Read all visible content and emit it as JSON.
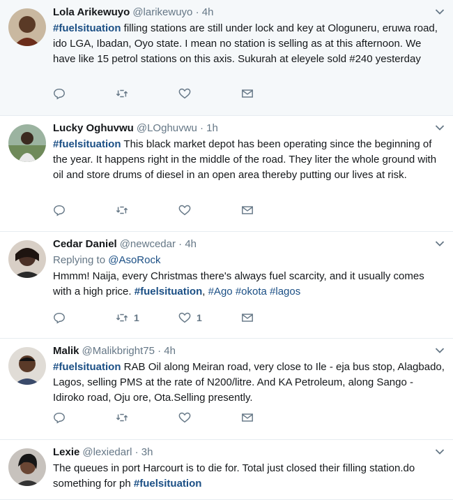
{
  "tweets": [
    {
      "name": "Lola Arikewuyo",
      "handle": "@larikewuyo",
      "time": "4h",
      "segments": [
        {
          "t": "#fuelsituation",
          "k": "tag"
        },
        {
          "t": " filling stations are still under lock and key at Ologuneru, eruwa road, ido LGA, Ibadan, Oyo state. I mean no station is selling as at this afternoon. We have like 15 petrol stations on this axis. Sukurah at eleyele sold #240 yesterday",
          "k": "plain"
        }
      ],
      "retweets": "",
      "likes": ""
    },
    {
      "name": "Lucky Oghuvwu",
      "handle": "@LOghuvwu",
      "time": "1h",
      "segments": [
        {
          "t": "#fuelsituation",
          "k": "tag"
        },
        {
          "t": " This black market depot has been operating since the beginning of the year. It happens right in the middle of the road. They liter the whole ground with oil and store drums of diesel in an open area thereby putting our lives at risk.",
          "k": "plain"
        }
      ],
      "retweets": "",
      "likes": ""
    },
    {
      "name": "Cedar Daniel",
      "handle": "@newcedar",
      "time": "4h",
      "replying_prefix": "Replying to",
      "replying_to": "@AsoRock",
      "segments": [
        {
          "t": "Hmmm!  Naija, every Christmas there's always fuel scarcity, and it usually comes with a high price. ",
          "k": "plain"
        },
        {
          "t": "#fuelsituation",
          "k": "tag"
        },
        {
          "t": ", ",
          "k": "plain"
        },
        {
          "t": "#Ago",
          "k": "mention"
        },
        {
          "t": " ",
          "k": "plain"
        },
        {
          "t": "#okota",
          "k": "mention"
        },
        {
          "t": " ",
          "k": "plain"
        },
        {
          "t": "#lagos",
          "k": "mention"
        }
      ],
      "retweets": "1",
      "likes": "1"
    },
    {
      "name": "Malik",
      "handle": "@Malikbright75",
      "time": "4h",
      "segments": [
        {
          "t": "#fuelsituation",
          "k": "tag"
        },
        {
          "t": " RAB Oil along Meiran road, very close to Ile - eja bus stop, Alagbado, Lagos, selling PMS at the rate of N200/litre. And KA Petroleum, along Sango - Idiroko road, Oju ore, Ota.Selling presently.",
          "k": "plain"
        }
      ],
      "retweets": "",
      "likes": ""
    },
    {
      "name": "Lexie",
      "handle": "@lexiedarl",
      "time": "3h",
      "segments": [
        {
          "t": "The queues in port Harcourt is to die for. Total just closed their filling station.do something for ph  ",
          "k": "plain"
        },
        {
          "t": "#fuelsituation",
          "k": "tag"
        }
      ],
      "retweets": "",
      "likes": ""
    }
  ],
  "separator": "·",
  "colors": {
    "hashtag": "#1b4f85",
    "meta": "#657786",
    "highlight_bg": "#f5f8fa",
    "divider": "#e6ecf0"
  },
  "icons": {
    "reply": "reply-icon",
    "retweet": "retweet-icon",
    "like": "heart-icon",
    "dm": "envelope-icon",
    "menu": "chevron-down-icon"
  }
}
